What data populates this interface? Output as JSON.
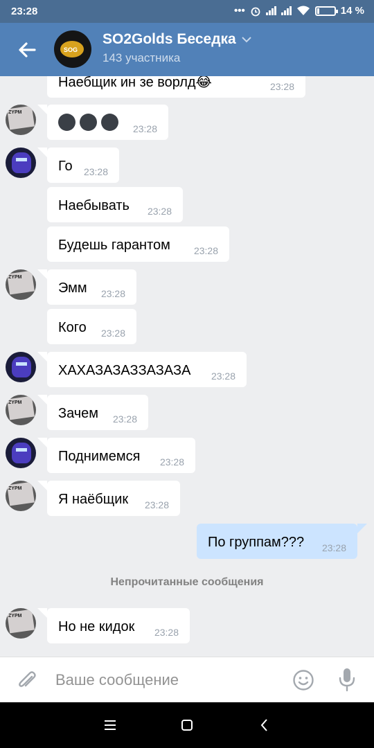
{
  "status": {
    "time": "23:28",
    "more": "•••",
    "battery": "14 %",
    "battery_level": 0.14
  },
  "header": {
    "title": "SO2Golds Беседка",
    "subtitle": "143 участника",
    "avatar_text": "SOG"
  },
  "messages": [
    {
      "side": "in",
      "text": "Наебщик ин зе ворлд😂",
      "time": "23:28"
    },
    {
      "side": "in",
      "text": "",
      "time": "23:28",
      "emoji_count": 3
    },
    {
      "side": "in",
      "text": "Го",
      "time": "23:28"
    },
    {
      "side": "in",
      "text": "Наебывать",
      "time": "23:28"
    },
    {
      "side": "in",
      "text": "Будешь гарантом",
      "time": "23:28"
    },
    {
      "side": "in",
      "text": "Эмм",
      "time": "23:28"
    },
    {
      "side": "in",
      "text": "Кого",
      "time": "23:28"
    },
    {
      "side": "in",
      "text": "ХАХАЗАЗАЗЗАЗАЗА",
      "time": "23:28"
    },
    {
      "side": "in",
      "text": "Зачем",
      "time": "23:28"
    },
    {
      "side": "in",
      "text": "Поднимемся",
      "time": "23:28"
    },
    {
      "side": "in",
      "text": "Я наёбщик",
      "time": "23:28"
    },
    {
      "side": "out",
      "text": "По группам???",
      "time": "23:28"
    },
    {
      "side": "in",
      "text": "Но не кидок",
      "time": "23:28"
    }
  ],
  "unread_label": "Непрочитанные сообщения",
  "compose": {
    "placeholder": "Ваше сообщение"
  },
  "colors": {
    "header": "#5181b8",
    "status_bar": "#4a6d93",
    "incoming_bubble": "#ffffff",
    "outgoing_bubble": "#cce4ff",
    "background": "#edeef0"
  }
}
